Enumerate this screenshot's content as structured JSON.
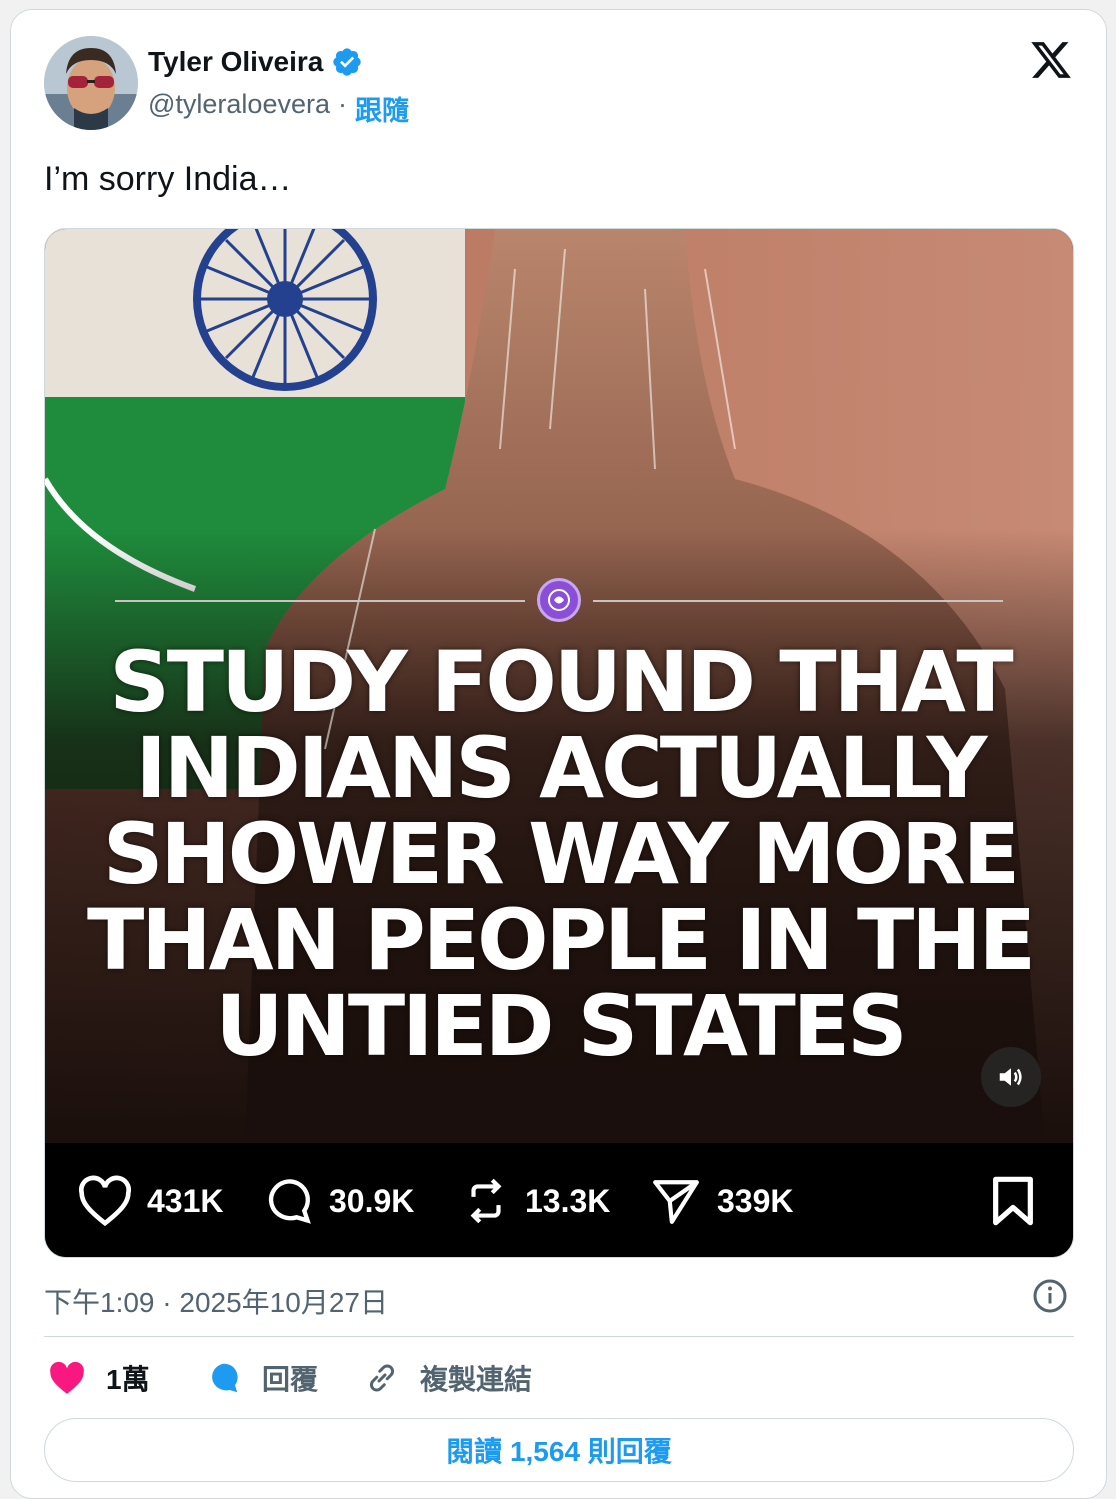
{
  "author": {
    "name": "Tyler Oliveira",
    "handle": "@tyleraloevera",
    "separator": "·",
    "follow_label": "跟隨",
    "verified_icon": "verified-badge-icon"
  },
  "tweet": {
    "text": "I’m sorry India…",
    "media": {
      "headline": "STUDY FOUND THAT INDIANS ACTUALLY SHOWER WAY MORE THAN PEOPLE IN THE UNTIED STATES",
      "likes": "431K",
      "comments": "30.9K",
      "reposts": "13.3K",
      "shares": "339K"
    },
    "timestamp": "下午1:09 · 2025年10月27日"
  },
  "actions": {
    "like_count": "1萬",
    "reply_label": "回覆",
    "copy_link_label": "複製連結"
  },
  "read_replies_label": "閱讀 1,564 則回覆",
  "colors": {
    "accent": "#1d9bf0",
    "like": "#f91880",
    "muted": "#536471"
  }
}
